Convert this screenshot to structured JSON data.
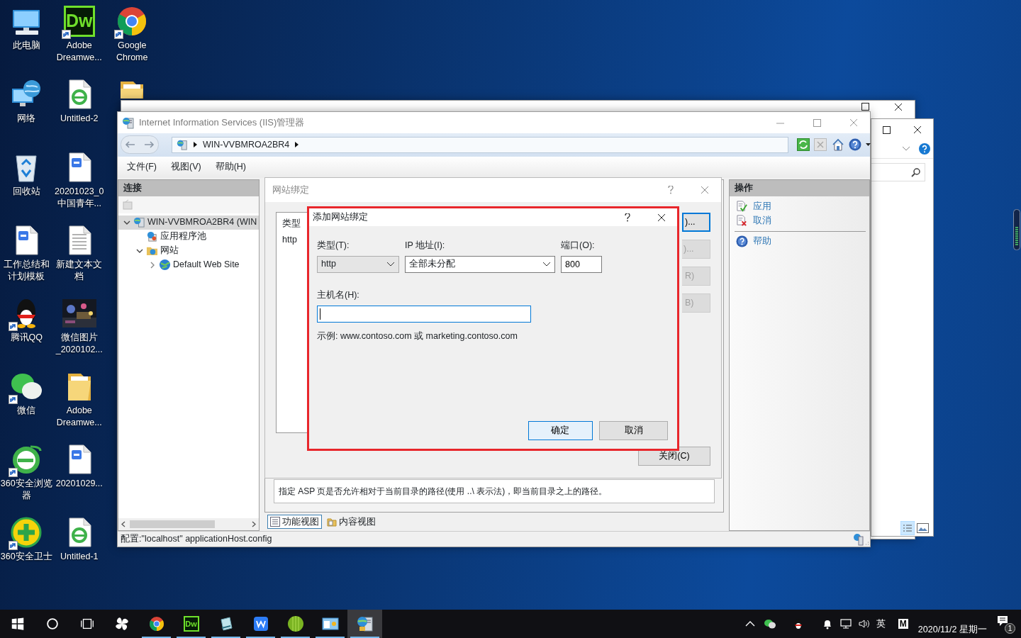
{
  "desktop_icons": [
    {
      "label": "此电脑",
      "kind": "computer",
      "shortcut": false
    },
    {
      "label": "网络",
      "kind": "network",
      "shortcut": false
    },
    {
      "label": "回收站",
      "kind": "recycle",
      "shortcut": false
    },
    {
      "label": "工作总结和计划模板",
      "kind": "word",
      "shortcut": false
    },
    {
      "label": "腾讯QQ",
      "kind": "penguin",
      "shortcut": true
    },
    {
      "label": "微信",
      "kind": "chat",
      "shortcut": true
    },
    {
      "label": "360安全浏览器",
      "kind": "ebrowser",
      "shortcut": true
    },
    {
      "label": "360安全卫士",
      "kind": "shield",
      "shortcut": true
    },
    {
      "label": "Adobe Dreamwe...",
      "kind": "dw",
      "logo": "Dw",
      "shortcut": true
    },
    {
      "label": "Untitled-2",
      "kind": "html",
      "shortcut": false
    },
    {
      "label": "20201023_0中国青年...",
      "kind": "word",
      "shortcut": false
    },
    {
      "label": "新建文本文档",
      "kind": "text",
      "shortcut": false
    },
    {
      "label": "微信图片_2020102...",
      "shortcut": false
    },
    {
      "label": "Adobe Dreamwe...",
      "kind": "folder",
      "shortcut": false
    },
    {
      "label": "20201029...",
      "kind": "word",
      "shortcut": false
    },
    {
      "label": "Untitled-1",
      "kind": "html",
      "shortcut": false
    },
    {
      "label": "Google Chrome",
      "kind": "chrome",
      "shortcut": true
    },
    {
      "kind": "folder",
      "shortcut": false
    }
  ],
  "iis": {
    "title": "Internet Information Services (IIS)管理器",
    "breadcrumb": [
      "WIN-VVBMROA2BR4"
    ],
    "menu": [
      "文件(F)",
      "视图(V)",
      "帮助(H)"
    ],
    "connections": {
      "title": "连接",
      "tree": [
        {
          "label": "WIN-VVBMROA2BR4 (WIN",
          "kind": "server",
          "selected": true,
          "expanded": true,
          "children": [
            {
              "label": "应用程序池",
              "kind": "pool",
              "selected": false
            },
            {
              "label": "网站",
              "kind": "sites",
              "selected": false,
              "expanded": true,
              "children": [
                {
                  "label": "Default Web Site",
                  "kind": "site",
                  "selected": false,
                  "expanded": false
                }
              ]
            }
          ]
        }
      ]
    },
    "description": "指定 ASP 页是否允许相对于当前目录的路径(使用 ..\\ 表示法)，即当前目录之上的路径。",
    "view_tabs": [
      {
        "label": "功能视图",
        "selected": true
      },
      {
        "label": "内容视图",
        "selected": false
      }
    ],
    "actions": {
      "title": "操作",
      "items": [
        {
          "label": "应用",
          "kind": "apply"
        },
        {
          "label": "取消",
          "kind": "cancel"
        },
        {
          "label": "帮助",
          "kind": "help"
        }
      ]
    },
    "status": "配置:\"localhost\" applicationHost.config"
  },
  "bindings_dialog": {
    "title": "网站绑定",
    "columns": [
      "类型"
    ],
    "rows": [
      [
        "http"
      ]
    ],
    "buttons": [
      {
        "label": ")...",
        "default": true,
        "disabled": false
      },
      {
        "label": ")...",
        "default": false,
        "disabled": true
      },
      {
        "label": "R)",
        "default": false,
        "disabled": true
      },
      {
        "label": "B)",
        "default": false,
        "disabled": true
      }
    ],
    "close_button": "关闭(C)"
  },
  "add_dialog": {
    "title": "添加网站绑定",
    "type": {
      "label": "类型(T):",
      "value": "http"
    },
    "ip": {
      "label": "IP 地址(I):",
      "value": "全部未分配"
    },
    "port": {
      "label": "端口(O):",
      "value": "800"
    },
    "host": {
      "label": "主机名(H):",
      "focused": true
    },
    "example": "示例: www.contoso.com 或 marketing.contoso.com",
    "ok": "确定",
    "cancel": "取消"
  },
  "taskbar": {
    "apps": [
      {
        "kind": "pinwheel",
        "running": false,
        "active": false
      },
      {
        "kind": "chrome",
        "running": true,
        "active": false
      },
      {
        "kind": "dw",
        "logo": "Dw",
        "running": true,
        "active": false
      },
      {
        "kind": "notepad",
        "running": true,
        "active": false
      },
      {
        "kind": "wps",
        "running": true,
        "active": false
      },
      {
        "kind": "ball",
        "running": true,
        "active": false
      },
      {
        "kind": "panel",
        "running": true,
        "active": false
      },
      {
        "kind": "server",
        "running": true,
        "active": true
      }
    ],
    "language": "英",
    "ime": "M",
    "date": "2020/11/2 星期一",
    "notifications": "1"
  }
}
